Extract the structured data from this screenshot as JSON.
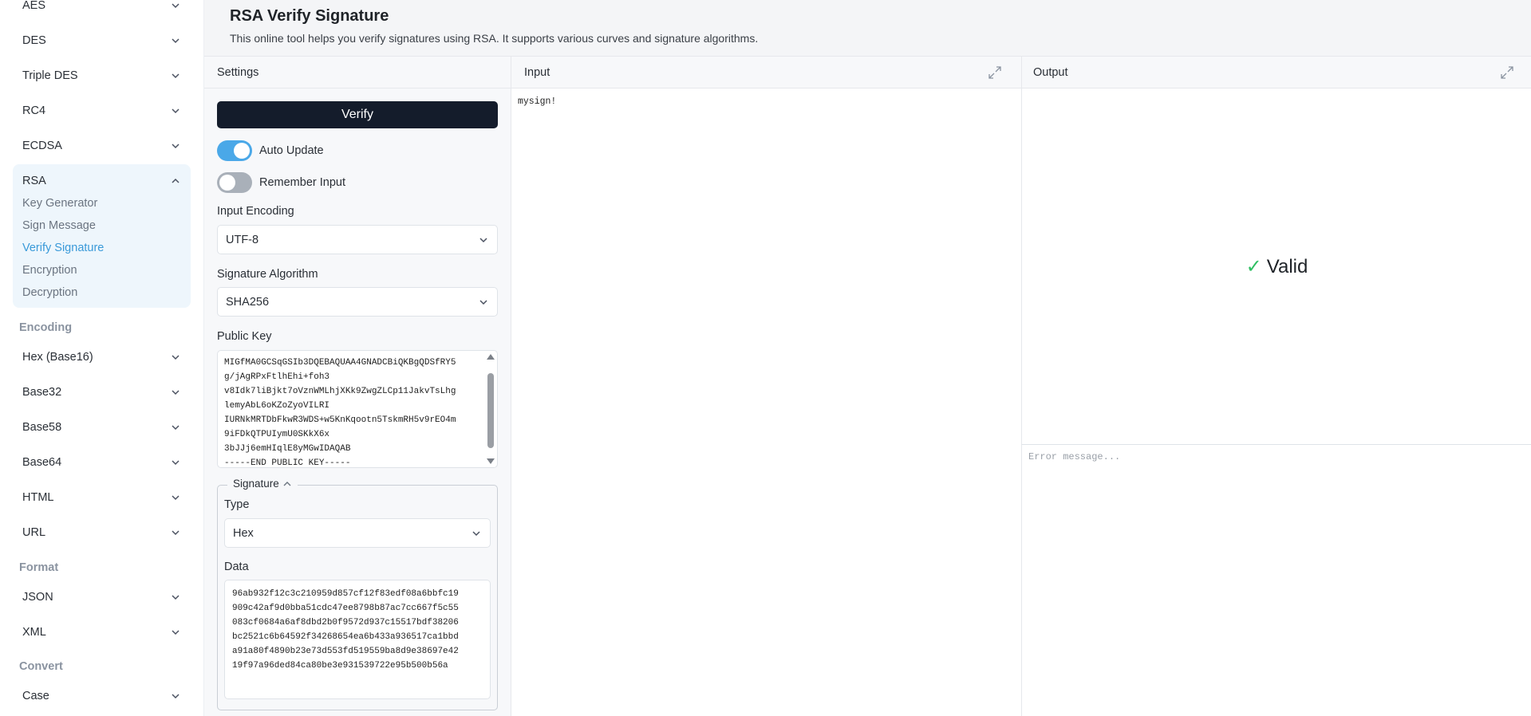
{
  "sidebar": {
    "items_top": [
      {
        "label": "AES"
      },
      {
        "label": "DES"
      },
      {
        "label": "Triple DES"
      },
      {
        "label": "RC4"
      },
      {
        "label": "ECDSA"
      },
      {
        "label": "RSA"
      }
    ],
    "rsa_subitems": [
      {
        "label": "Key Generator",
        "active": false
      },
      {
        "label": "Sign Message",
        "active": false
      },
      {
        "label": "Verify Signature",
        "active": true
      },
      {
        "label": "Encryption",
        "active": false
      },
      {
        "label": "Decryption",
        "active": false
      }
    ],
    "groups": {
      "encoding": "Encoding",
      "format": "Format",
      "convert": "Convert"
    },
    "encoding_items": [
      {
        "label": "Hex (Base16)"
      },
      {
        "label": "Base32"
      },
      {
        "label": "Base58"
      },
      {
        "label": "Base64"
      },
      {
        "label": "HTML"
      },
      {
        "label": "URL"
      }
    ],
    "format_items": [
      {
        "label": "JSON"
      },
      {
        "label": "XML"
      }
    ],
    "convert_items": [
      {
        "label": "Case"
      }
    ]
  },
  "header": {
    "title": "RSA Verify Signature",
    "description": "This online tool helps you verify signatures using RSA. It supports various curves and signature algorithms."
  },
  "panels": {
    "settings": "Settings",
    "input": "Input",
    "output": "Output"
  },
  "settings": {
    "verify_label": "Verify",
    "auto_update_label": "Auto Update",
    "auto_update_on": true,
    "remember_input_label": "Remember Input",
    "remember_input_on": false,
    "input_encoding_label": "Input Encoding",
    "input_encoding_value": "UTF-8",
    "sig_algorithm_label": "Signature Algorithm",
    "sig_algorithm_value": "SHA256",
    "public_key_label": "Public Key",
    "public_key_value": "MIGfMA0GCSqGSIb3DQEBAQUAA4GNADCBiQKBgQDSfRY5\ng/jAgRPxFtlhEhi+foh3\nv8Idk7liBjkt7oVznWMLhjXKk9ZwgZLCp11JakvTsLhg\nlemyAbL6oKZoZyoVILRI\nIURNkMRTDbFkwR3WDS+w5KnKqootn5TskmRH5v9rEO4m\n9iFDkQTPUIymU0SKkX6x\n3bJJj6emHIqlE8yMGwIDAQAB\n-----END PUBLIC KEY-----",
    "signature": {
      "legend": "Signature",
      "type_label": "Type",
      "type_value": "Hex",
      "data_label": "Data",
      "data_value": "96ab932f12c3c210959d857cf12f83edf08a6bbfc19\n909c42af9d0bba51cdc47ee8798b87ac7cc667f5c55\n083cf0684a6af8dbd2b0f9572d937c15517bdf38206\nbc2521c6b64592f34268654ea6b433a936517ca1bbd\na91a80f4890b23e73d553fd519559ba8d9e38697e42\n19f97a96ded84ca80be3e931539722e95b500b56a"
    }
  },
  "input": {
    "value": "mysign!"
  },
  "output": {
    "check": "✓",
    "result": "Valid",
    "error_placeholder": "Error message..."
  },
  "colors": {
    "accent": "#4aa8e8",
    "verify_button": "#141c2b",
    "valid_check": "#2fbf62",
    "active_link": "#3a9ad9"
  }
}
